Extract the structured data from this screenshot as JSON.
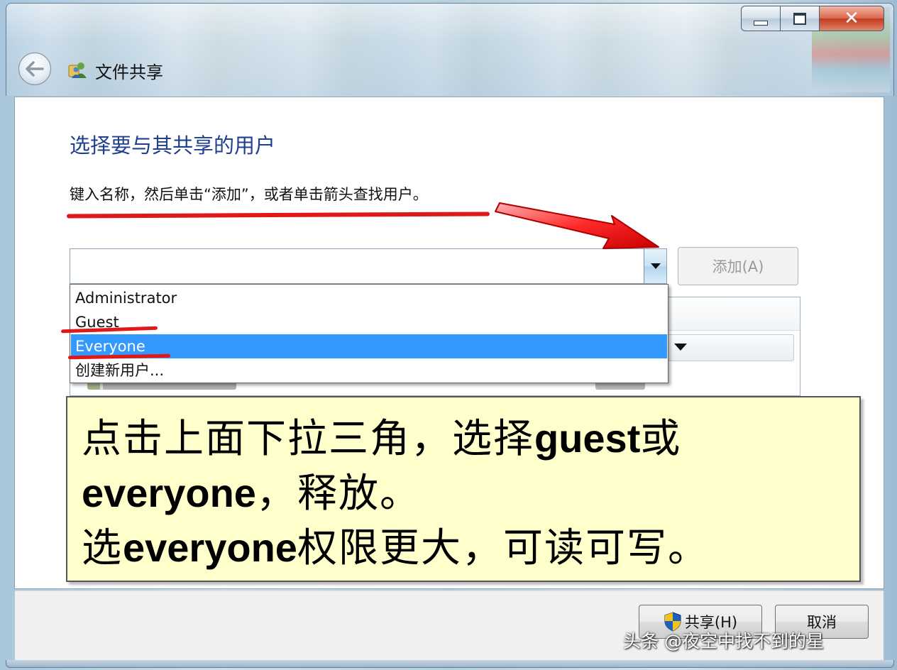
{
  "window": {
    "title": "文件共享",
    "minimize_icon": "minimize-icon",
    "maximize_icon": "maximize-icon",
    "close_label": "✕"
  },
  "main": {
    "heading": "选择要与其共享的用户",
    "instruction": "键入名称，然后单击“添加”，或者单击箭头查找用户。",
    "name_input_value": "",
    "add_button": "添加(A)"
  },
  "dropdown": {
    "items": [
      {
        "label": "Administrator",
        "selected": false
      },
      {
        "label": "Guest",
        "selected": false
      },
      {
        "label": "Everyone",
        "selected": true
      },
      {
        "label": "创建新用户...",
        "selected": false
      }
    ]
  },
  "callout": {
    "line1_a": "点击上面下拉三角，选择",
    "line1_b": "guest",
    "line1_c": "或",
    "line2_a": "everyone",
    "line2_b": "，释放。",
    "line3_a": "选",
    "line3_b": "everyone",
    "line3_c": "权限更大，可读可写。"
  },
  "footer": {
    "share_button": "共享(H)",
    "cancel_button": "取消"
  },
  "watermark": "头条 @夜空中找不到的星",
  "colors": {
    "heading": "#1f3f8f",
    "selection": "#3399ff",
    "annotation_red": "#e01818",
    "callout_bg": "#ffffcc"
  }
}
